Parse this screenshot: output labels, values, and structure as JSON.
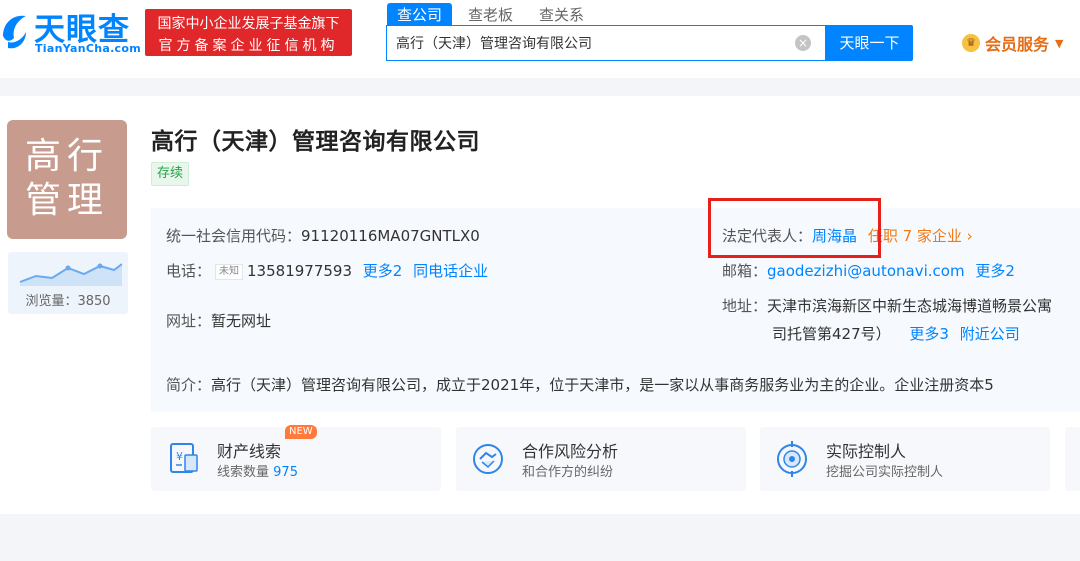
{
  "header": {
    "logo_text": "天眼查",
    "logo_sub": "TianYanCha.com",
    "gov_line1": "国家中小企业发展子基金旗下",
    "gov_line2": "官方备案企业征信机构",
    "search_tabs": [
      "查公司",
      "查老板",
      "查关系"
    ],
    "search_value": "高行（天津）管理咨询有限公司",
    "search_button": "天眼一下",
    "vip_label": "会员服务",
    "vip_caret": "▼"
  },
  "company": {
    "logo_line1": "高行",
    "logo_line2": "管理",
    "views_label": "浏览量：",
    "views_count": "3850",
    "name": "高行（天津）管理咨询有限公司",
    "status": "存续",
    "credit_code_label": "统一社会信用代码：",
    "credit_code": "91120116MA07GNTLX0",
    "phone_label": "电话：",
    "phone_tag": "未知",
    "phone": "13581977593",
    "phone_more": "更多2",
    "phone_same": "同电话企业",
    "website_label": "网址：",
    "website": "暂无网址",
    "legal_rep_label": "法定代表人：",
    "legal_rep": "周海晶",
    "positions": "任职 7 家企业 ›",
    "email_label": "邮箱：",
    "email": "gaodezizhi@autonavi.com",
    "email_more": "更多2",
    "address_label": "地址：",
    "address_line1": "天津市滨海新区中新生态城海博道畅景公寓",
    "address_line2": "司托管第427号）",
    "address_more": "更多3",
    "address_nearby": "附近公司",
    "intro_label": "简介：",
    "intro": "高行（天津）管理咨询有限公司，成立于2021年，位于天津市，是一家以从事商务服务业为主的企业。企业注册资本5"
  },
  "features": [
    {
      "title": "财产线索",
      "badge": "NEW",
      "sub": "线索数量",
      "num": "975"
    },
    {
      "title": "合作风险分析",
      "sub": "和合作方的纠纷"
    },
    {
      "title": "实际控制人",
      "sub": "挖掘公司实际控制人"
    }
  ],
  "colors": {
    "brand": "#0084ff",
    "gov_red": "#e0282a",
    "highlight_red": "#e8201c",
    "orange": "#f07b16"
  }
}
